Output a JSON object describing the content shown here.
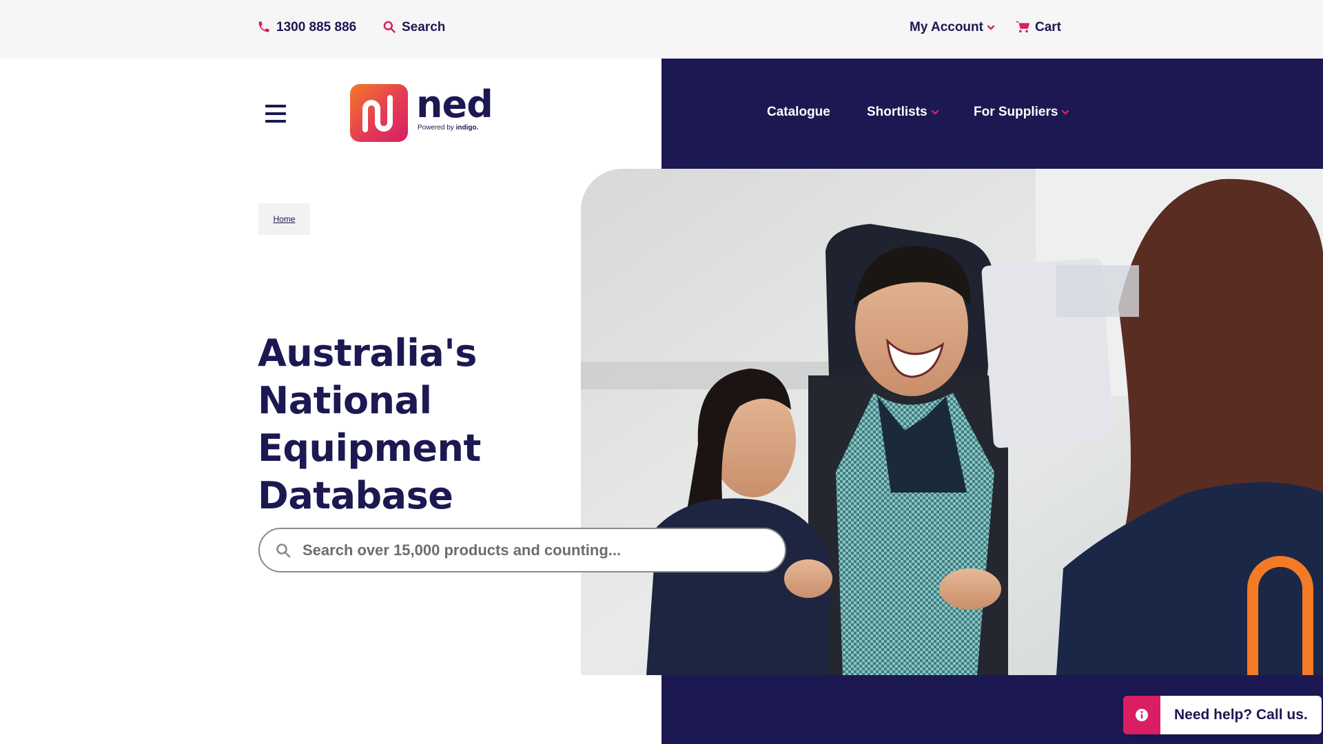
{
  "topbar": {
    "phone": "1300 885 886",
    "search_label": "Search",
    "account_label": "My Account",
    "cart_label": "Cart"
  },
  "logo": {
    "wordmark": "ned",
    "powered_by": "Powered by",
    "brand": "indigo."
  },
  "nav": {
    "items": [
      {
        "label": "Catalogue",
        "has_dropdown": false
      },
      {
        "label": "Shortlists",
        "has_dropdown": true
      },
      {
        "label": "For Suppliers",
        "has_dropdown": true
      }
    ]
  },
  "breadcrumb": {
    "home": "Home"
  },
  "hero": {
    "title_lines": [
      "Australia's",
      "National",
      "Equipment",
      "Database"
    ],
    "search_placeholder": "Search over 15,000 products and counting..."
  },
  "help": {
    "label": "Need help? Call us."
  },
  "colors": {
    "navy": "#1c1852",
    "accent_pink": "#d91e63",
    "accent_orange": "#f47a26",
    "topbar_bg": "#f6f6f6"
  },
  "icons": {
    "phone": "phone-icon",
    "search": "search-icon",
    "chevron": "chevron-down-icon",
    "cart": "cart-icon",
    "menu": "hamburger-menu-icon",
    "info": "info-icon"
  }
}
